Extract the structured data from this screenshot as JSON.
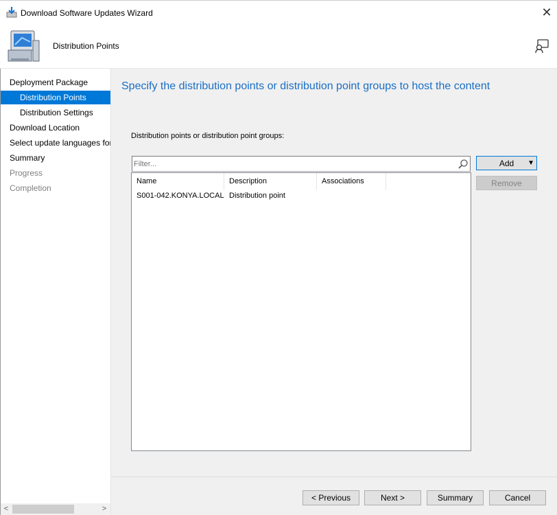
{
  "window": {
    "title": "Download Software Updates Wizard",
    "close_glyph": "✕"
  },
  "header": {
    "page_name": "Distribution Points"
  },
  "sidebar": {
    "items": [
      {
        "label": "Deployment Package",
        "state": "normal"
      },
      {
        "label": "Distribution Points",
        "state": "active"
      },
      {
        "label": "Distribution Settings",
        "state": "normal"
      },
      {
        "label": "Download Location",
        "state": "normal"
      },
      {
        "label": "Select update languages for",
        "state": "normal"
      },
      {
        "label": "Summary",
        "state": "normal"
      },
      {
        "label": "Progress",
        "state": "disabled"
      },
      {
        "label": "Completion",
        "state": "disabled"
      }
    ],
    "scroll_left": "<",
    "scroll_right": ">"
  },
  "main": {
    "heading": "Specify the distribution points or distribution point groups to host the content",
    "section_label": "Distribution points or distribution point groups:",
    "filter_placeholder": "Filter...",
    "columns": [
      "Name",
      "Description",
      "Associations"
    ],
    "rows": [
      [
        "S001-042.KONYA.LOCAL",
        "Distribution point",
        ""
      ]
    ],
    "add_button": "Add",
    "remove_button": "Remove"
  },
  "footer": {
    "previous": "< Previous",
    "next": "Next >",
    "summary": "Summary",
    "cancel": "Cancel"
  },
  "colors": {
    "accent": "#0078d7",
    "heading": "#1a6fc4",
    "panel": "#f0f0f0"
  },
  "icons": [
    "download-wizard-icon",
    "computer-icon",
    "help-icon",
    "search-icon",
    "dropdown-arrow-icon"
  ]
}
